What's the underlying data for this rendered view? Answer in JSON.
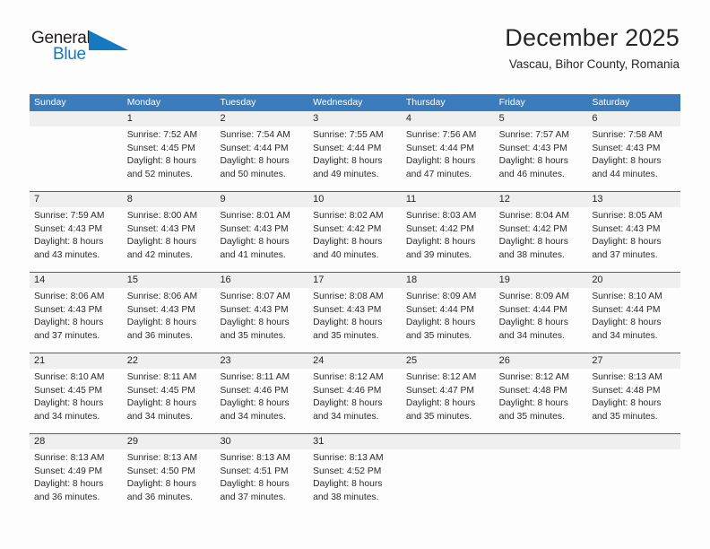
{
  "brand": {
    "name_top": "General",
    "name_bottom": "Blue",
    "accent_color": "#1579c0"
  },
  "header": {
    "title": "December 2025",
    "subtitle": "Vascau, Bihor County, Romania"
  },
  "theme": {
    "header_blue": "#3b7cbd",
    "row_divider_blue": "#2e6da8",
    "date_band_gray": "#efefef",
    "page_background": "#fdfdfd",
    "text_color": "#262626"
  },
  "weekdays": [
    "Sunday",
    "Monday",
    "Tuesday",
    "Wednesday",
    "Thursday",
    "Friday",
    "Saturday"
  ],
  "weeks": [
    [
      {
        "day": "",
        "lines": []
      },
      {
        "day": "1",
        "lines": [
          "Sunrise: 7:52 AM",
          "Sunset: 4:45 PM",
          "Daylight: 8 hours",
          "and 52 minutes."
        ]
      },
      {
        "day": "2",
        "lines": [
          "Sunrise: 7:54 AM",
          "Sunset: 4:44 PM",
          "Daylight: 8 hours",
          "and 50 minutes."
        ]
      },
      {
        "day": "3",
        "lines": [
          "Sunrise: 7:55 AM",
          "Sunset: 4:44 PM",
          "Daylight: 8 hours",
          "and 49 minutes."
        ]
      },
      {
        "day": "4",
        "lines": [
          "Sunrise: 7:56 AM",
          "Sunset: 4:44 PM",
          "Daylight: 8 hours",
          "and 47 minutes."
        ]
      },
      {
        "day": "5",
        "lines": [
          "Sunrise: 7:57 AM",
          "Sunset: 4:43 PM",
          "Daylight: 8 hours",
          "and 46 minutes."
        ]
      },
      {
        "day": "6",
        "lines": [
          "Sunrise: 7:58 AM",
          "Sunset: 4:43 PM",
          "Daylight: 8 hours",
          "and 44 minutes."
        ]
      }
    ],
    [
      {
        "day": "7",
        "lines": [
          "Sunrise: 7:59 AM",
          "Sunset: 4:43 PM",
          "Daylight: 8 hours",
          "and 43 minutes."
        ]
      },
      {
        "day": "8",
        "lines": [
          "Sunrise: 8:00 AM",
          "Sunset: 4:43 PM",
          "Daylight: 8 hours",
          "and 42 minutes."
        ]
      },
      {
        "day": "9",
        "lines": [
          "Sunrise: 8:01 AM",
          "Sunset: 4:43 PM",
          "Daylight: 8 hours",
          "and 41 minutes."
        ]
      },
      {
        "day": "10",
        "lines": [
          "Sunrise: 8:02 AM",
          "Sunset: 4:42 PM",
          "Daylight: 8 hours",
          "and 40 minutes."
        ]
      },
      {
        "day": "11",
        "lines": [
          "Sunrise: 8:03 AM",
          "Sunset: 4:42 PM",
          "Daylight: 8 hours",
          "and 39 minutes."
        ]
      },
      {
        "day": "12",
        "lines": [
          "Sunrise: 8:04 AM",
          "Sunset: 4:42 PM",
          "Daylight: 8 hours",
          "and 38 minutes."
        ]
      },
      {
        "day": "13",
        "lines": [
          "Sunrise: 8:05 AM",
          "Sunset: 4:43 PM",
          "Daylight: 8 hours",
          "and 37 minutes."
        ]
      }
    ],
    [
      {
        "day": "14",
        "lines": [
          "Sunrise: 8:06 AM",
          "Sunset: 4:43 PM",
          "Daylight: 8 hours",
          "and 37 minutes."
        ]
      },
      {
        "day": "15",
        "lines": [
          "Sunrise: 8:06 AM",
          "Sunset: 4:43 PM",
          "Daylight: 8 hours",
          "and 36 minutes."
        ]
      },
      {
        "day": "16",
        "lines": [
          "Sunrise: 8:07 AM",
          "Sunset: 4:43 PM",
          "Daylight: 8 hours",
          "and 35 minutes."
        ]
      },
      {
        "day": "17",
        "lines": [
          "Sunrise: 8:08 AM",
          "Sunset: 4:43 PM",
          "Daylight: 8 hours",
          "and 35 minutes."
        ]
      },
      {
        "day": "18",
        "lines": [
          "Sunrise: 8:09 AM",
          "Sunset: 4:44 PM",
          "Daylight: 8 hours",
          "and 35 minutes."
        ]
      },
      {
        "day": "19",
        "lines": [
          "Sunrise: 8:09 AM",
          "Sunset: 4:44 PM",
          "Daylight: 8 hours",
          "and 34 minutes."
        ]
      },
      {
        "day": "20",
        "lines": [
          "Sunrise: 8:10 AM",
          "Sunset: 4:44 PM",
          "Daylight: 8 hours",
          "and 34 minutes."
        ]
      }
    ],
    [
      {
        "day": "21",
        "lines": [
          "Sunrise: 8:10 AM",
          "Sunset: 4:45 PM",
          "Daylight: 8 hours",
          "and 34 minutes."
        ]
      },
      {
        "day": "22",
        "lines": [
          "Sunrise: 8:11 AM",
          "Sunset: 4:45 PM",
          "Daylight: 8 hours",
          "and 34 minutes."
        ]
      },
      {
        "day": "23",
        "lines": [
          "Sunrise: 8:11 AM",
          "Sunset: 4:46 PM",
          "Daylight: 8 hours",
          "and 34 minutes."
        ]
      },
      {
        "day": "24",
        "lines": [
          "Sunrise: 8:12 AM",
          "Sunset: 4:46 PM",
          "Daylight: 8 hours",
          "and 34 minutes."
        ]
      },
      {
        "day": "25",
        "lines": [
          "Sunrise: 8:12 AM",
          "Sunset: 4:47 PM",
          "Daylight: 8 hours",
          "and 35 minutes."
        ]
      },
      {
        "day": "26",
        "lines": [
          "Sunrise: 8:12 AM",
          "Sunset: 4:48 PM",
          "Daylight: 8 hours",
          "and 35 minutes."
        ]
      },
      {
        "day": "27",
        "lines": [
          "Sunrise: 8:13 AM",
          "Sunset: 4:48 PM",
          "Daylight: 8 hours",
          "and 35 minutes."
        ]
      }
    ],
    [
      {
        "day": "28",
        "lines": [
          "Sunrise: 8:13 AM",
          "Sunset: 4:49 PM",
          "Daylight: 8 hours",
          "and 36 minutes."
        ]
      },
      {
        "day": "29",
        "lines": [
          "Sunrise: 8:13 AM",
          "Sunset: 4:50 PM",
          "Daylight: 8 hours",
          "and 36 minutes."
        ]
      },
      {
        "day": "30",
        "lines": [
          "Sunrise: 8:13 AM",
          "Sunset: 4:51 PM",
          "Daylight: 8 hours",
          "and 37 minutes."
        ]
      },
      {
        "day": "31",
        "lines": [
          "Sunrise: 8:13 AM",
          "Sunset: 4:52 PM",
          "Daylight: 8 hours",
          "and 38 minutes."
        ]
      },
      {
        "day": "",
        "lines": []
      },
      {
        "day": "",
        "lines": []
      },
      {
        "day": "",
        "lines": []
      }
    ]
  ]
}
